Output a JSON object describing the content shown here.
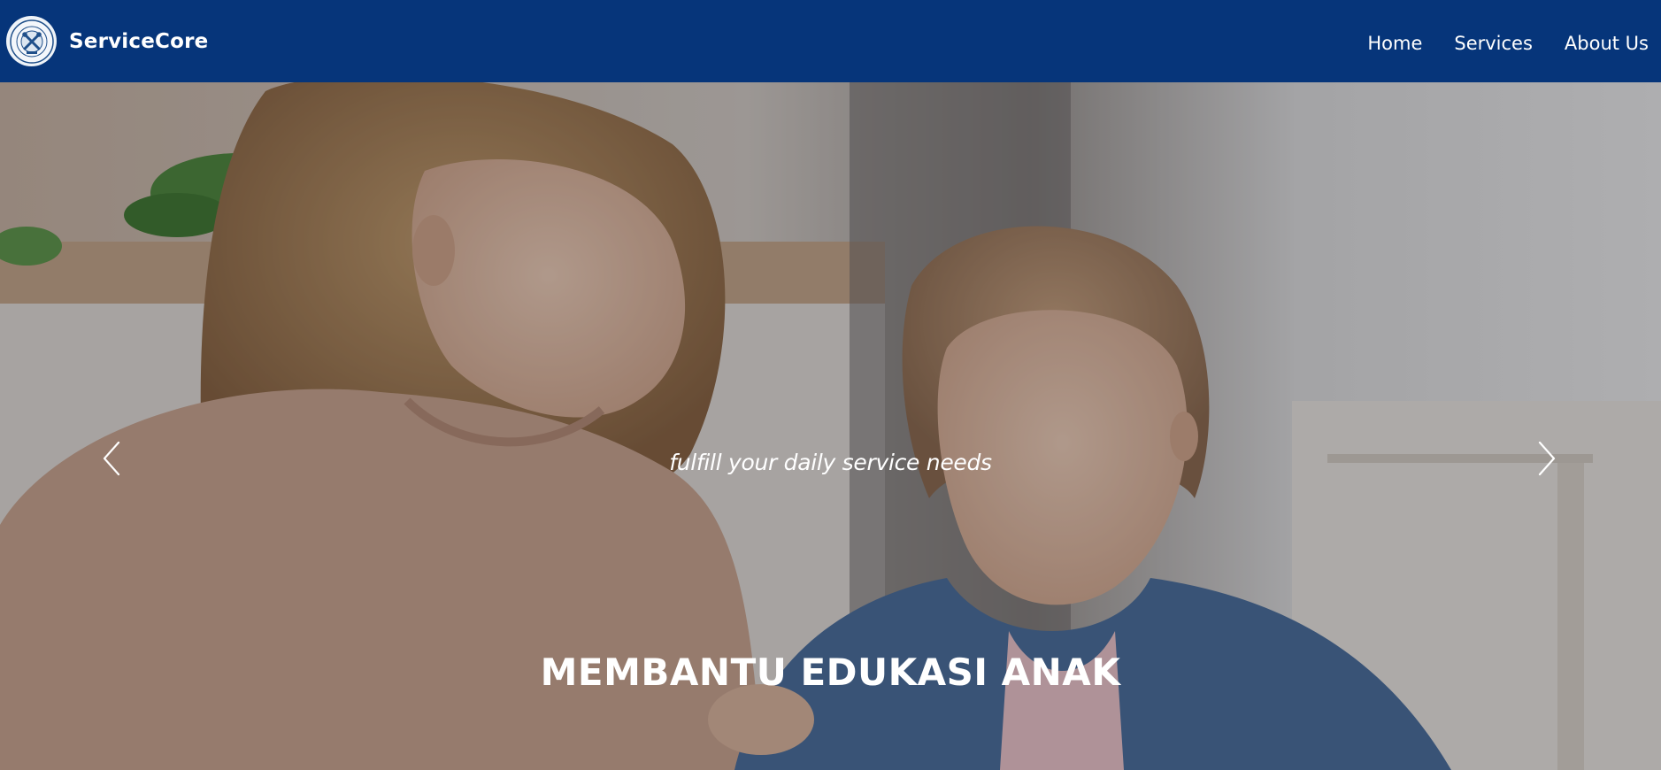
{
  "brand": {
    "name": "ServiceCore",
    "logo_icon": "servicecore-logo-icon"
  },
  "nav": {
    "items": [
      {
        "label": "Home"
      },
      {
        "label": "Services"
      },
      {
        "label": "About Us"
      }
    ]
  },
  "hero": {
    "tagline": "fulfill your daily service needs",
    "title": "MEMBANTU EDUKASI ANAK",
    "prev_icon": "chevron-left-icon",
    "next_icon": "chevron-right-icon",
    "image": "mother-helping-daughter-study-photo"
  },
  "colors": {
    "navbar_bg": "#06357a",
    "text_white": "#ffffff"
  }
}
